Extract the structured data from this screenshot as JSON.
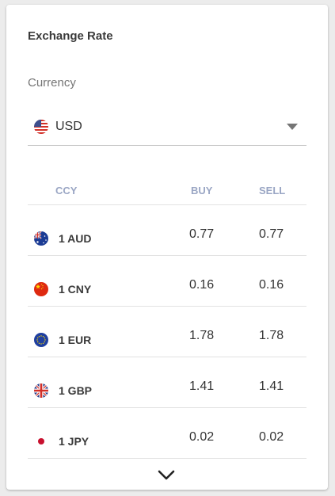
{
  "card": {
    "title": "Exchange Rate"
  },
  "currency_select": {
    "label": "Currency",
    "value": "USD",
    "flag_icon": "us-flag-icon"
  },
  "table": {
    "headers": {
      "ccy": "CCY",
      "buy": "BUY",
      "sell": "SELL"
    },
    "rows": [
      {
        "code": "1 AUD",
        "buy": "0.77",
        "sell": "0.77",
        "flag_icon": "australia-flag-icon"
      },
      {
        "code": "1 CNY",
        "buy": "0.16",
        "sell": "0.16",
        "flag_icon": "china-flag-icon"
      },
      {
        "code": "1 EUR",
        "buy": "1.78",
        "sell": "1.78",
        "flag_icon": "eu-flag-icon"
      },
      {
        "code": "1 GBP",
        "buy": "1.41",
        "sell": "1.41",
        "flag_icon": "uk-flag-icon"
      },
      {
        "code": "1 JPY",
        "buy": "0.02",
        "sell": "0.02",
        "flag_icon": "japan-flag-icon"
      }
    ]
  },
  "footer": {
    "expand_icon": "chevron-down-icon"
  },
  "colors": {
    "header_text": "#9aa6c4",
    "divider": "#e2e2e2",
    "caret": "#757575"
  }
}
